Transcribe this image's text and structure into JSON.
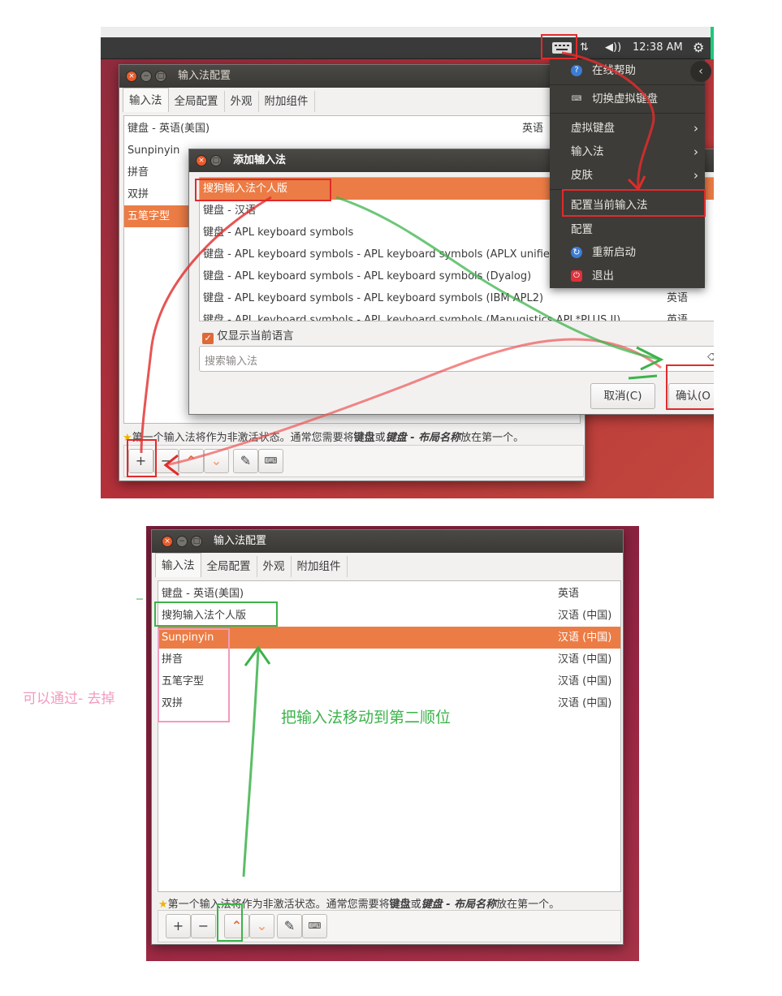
{
  "topbar": {
    "time": "12:38 AM"
  },
  "config_window": {
    "title": "输入法配置",
    "tabs": [
      "输入法",
      "全局配置",
      "外观",
      "附加组件"
    ],
    "rows": [
      {
        "name": "键盘 - 英语(美国)",
        "lang": "英语"
      },
      {
        "name": "Sunpinyin",
        "lang": ""
      },
      {
        "name": "拼音",
        "lang": ""
      },
      {
        "name": "双拼",
        "lang": ""
      },
      {
        "name": "五笔字型",
        "lang": ""
      }
    ],
    "hint_prefix": "第一个输入法将作为非激活状态。通常您需要将",
    "hint_bold1": "键盘",
    "hint_mid": "或",
    "hint_bold2": "键盘 - 布局名称",
    "hint_suffix": "放在第一个。",
    "toolbar": {
      "add": "+",
      "remove": "−",
      "up": "⌃",
      "down": "⌄"
    }
  },
  "add_dialog": {
    "title": "添加输入法",
    "rows": [
      {
        "name": "搜狗输入法个人版",
        "lang": ""
      },
      {
        "name": "键盘 - 汉语",
        "lang": ""
      },
      {
        "name": "键盘 - APL keyboard symbols",
        "lang": ""
      },
      {
        "name": "键盘 - APL keyboard symbols - APL keyboard symbols (APLX unified)",
        "lang": ""
      },
      {
        "name": "键盘 - APL keyboard symbols - APL keyboard symbols (Dyalog)",
        "lang": ""
      },
      {
        "name": "键盘 - APL keyboard symbols - APL keyboard symbols (IBM APL2)",
        "lang": "英语"
      },
      {
        "name": "键盘 - APL keyboard symbols - APL keyboard symbols (Manugistics APL*PLUS II)",
        "lang": "英语"
      }
    ],
    "only_current_language": "仅显示当前语言",
    "search_placeholder": "搜索输入法",
    "cancel": "取消(C)",
    "ok": "确认(O"
  },
  "tray_menu": {
    "items": [
      {
        "label": "在线帮助",
        "icon": "help-icon"
      },
      {
        "label": "切换虚拟键盘",
        "icon": "keyboard-icon"
      },
      {
        "label": "虚拟键盘",
        "submenu": "›"
      },
      {
        "label": "输入法",
        "submenu": "›"
      },
      {
        "label": "皮肤",
        "submenu": "›"
      },
      {
        "label": "配置当前输入法"
      },
      {
        "label": "配置"
      },
      {
        "label": "重新启动",
        "icon": "restart-icon"
      },
      {
        "label": "退出",
        "icon": "quit-icon"
      }
    ]
  },
  "result_window": {
    "title": "输入法配置",
    "tabs": [
      "输入法",
      "全局配置",
      "外观",
      "附加组件"
    ],
    "rows": [
      {
        "name": "键盘 - 英语(美国)",
        "lang": "英语"
      },
      {
        "name": "搜狗输入法个人版",
        "lang": "汉语 (中国)"
      },
      {
        "name": "Sunpinyin",
        "lang": "汉语 (中国)"
      },
      {
        "name": "拼音",
        "lang": "汉语 (中国)"
      },
      {
        "name": "五笔字型",
        "lang": "汉语 (中国)"
      },
      {
        "name": "双拼",
        "lang": "汉语 (中国)"
      }
    ],
    "hint_prefix": "第一个输入法将作为非激活状态。通常您需要将",
    "hint_bold1": "键盘",
    "hint_mid": "或",
    "hint_bold2": "键盘 - 布局名称",
    "hint_suffix": "放在第一个。",
    "toolbar": {
      "add": "+",
      "remove": "−",
      "up": "⌃",
      "down": "⌄"
    }
  },
  "annotations": {
    "pink_note": "可以通过- 去掉",
    "green_note": "把输入法移动到第二顺位"
  },
  "colors": {
    "selection": "#ec7c45",
    "annotation_red": "#e12b2b",
    "annotation_green": "#3db34b",
    "annotation_pink": "#f19bbf"
  }
}
